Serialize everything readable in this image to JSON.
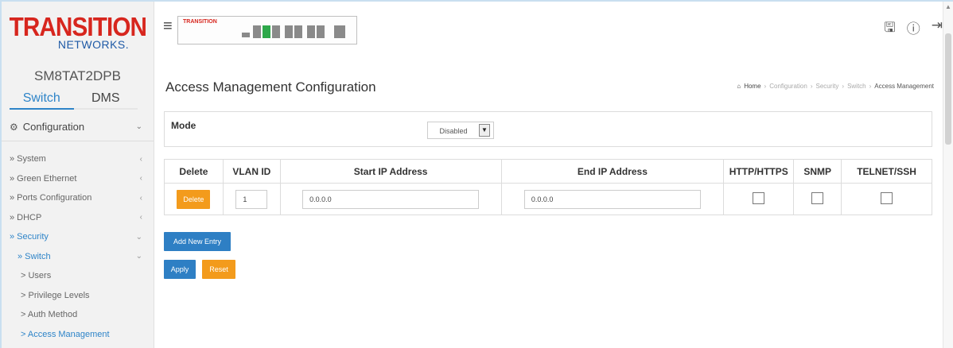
{
  "logo": {
    "main": "TRANSITION",
    "sub": "NETWORKS."
  },
  "device_name": "SM8TAT2DPB",
  "sidebar": {
    "tabs": [
      {
        "label": "Switch",
        "active": true
      },
      {
        "label": "DMS",
        "active": false
      }
    ],
    "section": "Configuration",
    "items": [
      {
        "label": "» System",
        "arrow": "‹"
      },
      {
        "label": "» Green Ethernet",
        "arrow": "‹"
      },
      {
        "label": "» Ports Configuration",
        "arrow": "‹"
      },
      {
        "label": "» DHCP",
        "arrow": "‹"
      },
      {
        "label": "» Security",
        "arrow": "⌄"
      },
      {
        "label": "» Switch",
        "arrow": "⌄"
      },
      {
        "label": "> Users",
        "arrow": ""
      },
      {
        "label": "> Privilege Levels",
        "arrow": ""
      },
      {
        "label": "> Auth Method",
        "arrow": ""
      },
      {
        "label": "> Access Management",
        "arrow": ""
      }
    ]
  },
  "topbar": {
    "device_logo": "TRANSITION"
  },
  "page": {
    "title": "Access Management Configuration",
    "breadcrumb": [
      "Home",
      "Configuration",
      "Security",
      "Switch",
      "Access Management"
    ]
  },
  "mode": {
    "label": "Mode",
    "value": "Disabled"
  },
  "table": {
    "headers": [
      "Delete",
      "VLAN ID",
      "Start IP Address",
      "End IP Address",
      "HTTP/HTTPS",
      "SNMP",
      "TELNET/SSH"
    ],
    "rows": [
      {
        "delete_label": "Delete",
        "vlan_id": "1",
        "start_ip": "0.0.0.0",
        "end_ip": "0.0.0.0",
        "http": false,
        "snmp": false,
        "telnet": false
      }
    ]
  },
  "buttons": {
    "add": "Add New Entry",
    "apply": "Apply",
    "reset": "Reset"
  },
  "colors": {
    "accent_blue": "#2e7fc4",
    "accent_orange": "#f39b1c",
    "brand_red": "#d7261e"
  }
}
